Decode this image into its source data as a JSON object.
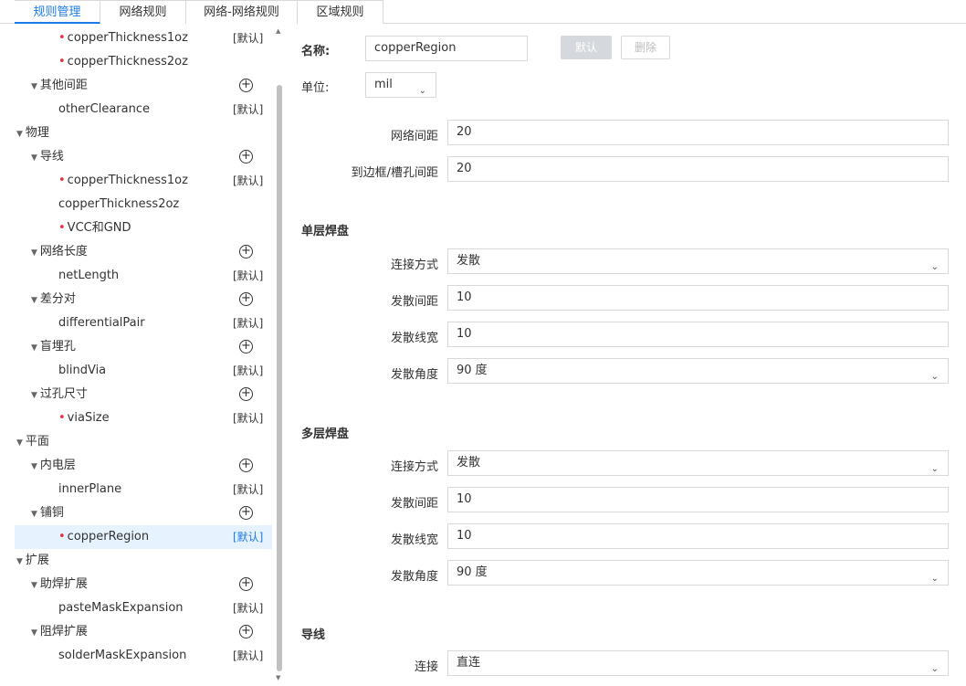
{
  "tabs": [
    {
      "label": "规则管理",
      "active": true
    },
    {
      "label": "网络规则",
      "active": false
    },
    {
      "label": "网络-网络规则",
      "active": false
    },
    {
      "label": "区域规则",
      "active": false
    }
  ],
  "tree": [
    {
      "indent": 2,
      "label": "copperThickness1oz",
      "star": true,
      "tag": "[默认]"
    },
    {
      "indent": 2,
      "label": "copperThickness2oz",
      "star": true
    },
    {
      "indent": 1,
      "label": "其他间距",
      "caret": true,
      "add": true
    },
    {
      "indent": 2,
      "label": "otherClearance",
      "tag": "[默认]"
    },
    {
      "indent": 0,
      "label": "物理",
      "caret": true
    },
    {
      "indent": 1,
      "label": "导线",
      "caret": true,
      "add": true
    },
    {
      "indent": 2,
      "label": "copperThickness1oz",
      "star": true,
      "tag": "[默认]"
    },
    {
      "indent": 2,
      "label": "copperThickness2oz"
    },
    {
      "indent": 2,
      "label": "VCC和GND",
      "star": true
    },
    {
      "indent": 1,
      "label": "网络长度",
      "caret": true,
      "add": true
    },
    {
      "indent": 2,
      "label": "netLength",
      "tag": "[默认]"
    },
    {
      "indent": 1,
      "label": "差分对",
      "caret": true,
      "add": true
    },
    {
      "indent": 2,
      "label": "differentialPair",
      "tag": "[默认]"
    },
    {
      "indent": 1,
      "label": "盲埋孔",
      "caret": true,
      "add": true
    },
    {
      "indent": 2,
      "label": "blindVia",
      "tag": "[默认]"
    },
    {
      "indent": 1,
      "label": "过孔尺寸",
      "caret": true,
      "add": true
    },
    {
      "indent": 2,
      "label": "viaSize",
      "star": true,
      "tag": "[默认]"
    },
    {
      "indent": 0,
      "label": "平面",
      "caret": true
    },
    {
      "indent": 1,
      "label": "内电层",
      "caret": true,
      "add": true
    },
    {
      "indent": 2,
      "label": "innerPlane",
      "tag": "[默认]"
    },
    {
      "indent": 1,
      "label": "铺铜",
      "caret": true,
      "add": true
    },
    {
      "indent": 2,
      "label": "copperRegion",
      "star": true,
      "tag": "[默认]",
      "selected": true
    },
    {
      "indent": 0,
      "label": "扩展",
      "caret": true
    },
    {
      "indent": 1,
      "label": "助焊扩展",
      "caret": true,
      "add": true
    },
    {
      "indent": 2,
      "label": "pasteMaskExpansion",
      "tag": "[默认]"
    },
    {
      "indent": 1,
      "label": "阻焊扩展",
      "caret": true,
      "add": true
    },
    {
      "indent": 2,
      "label": "solderMaskExpansion",
      "tag": "[默认]"
    }
  ],
  "form": {
    "name_label": "名称:",
    "name_value": "copperRegion",
    "default_btn": "默认",
    "delete_btn": "删除",
    "unit_label": "单位:",
    "unit_value": "mil",
    "net_clearance_label": "网络间距",
    "net_clearance_value": "20",
    "board_clearance_label": "到边框/槽孔间距",
    "board_clearance_value": "20",
    "single_pad_title": "单层焊盘",
    "single": {
      "connect_label": "连接方式",
      "connect_value": "发散",
      "spoke_gap_label": "发散间距",
      "spoke_gap_value": "10",
      "spoke_width_label": "发散线宽",
      "spoke_width_value": "10",
      "spoke_angle_label": "发散角度",
      "spoke_angle_value": "90 度"
    },
    "multi_pad_title": "多层焊盘",
    "multi": {
      "connect_label": "连接方式",
      "connect_value": "发散",
      "spoke_gap_label": "发散间距",
      "spoke_gap_value": "10",
      "spoke_width_label": "发散线宽",
      "spoke_width_value": "10",
      "spoke_angle_label": "发散角度",
      "spoke_angle_value": "90 度"
    },
    "track_title": "导线",
    "track_connect_label": "连接",
    "track_connect_value": "直连"
  }
}
